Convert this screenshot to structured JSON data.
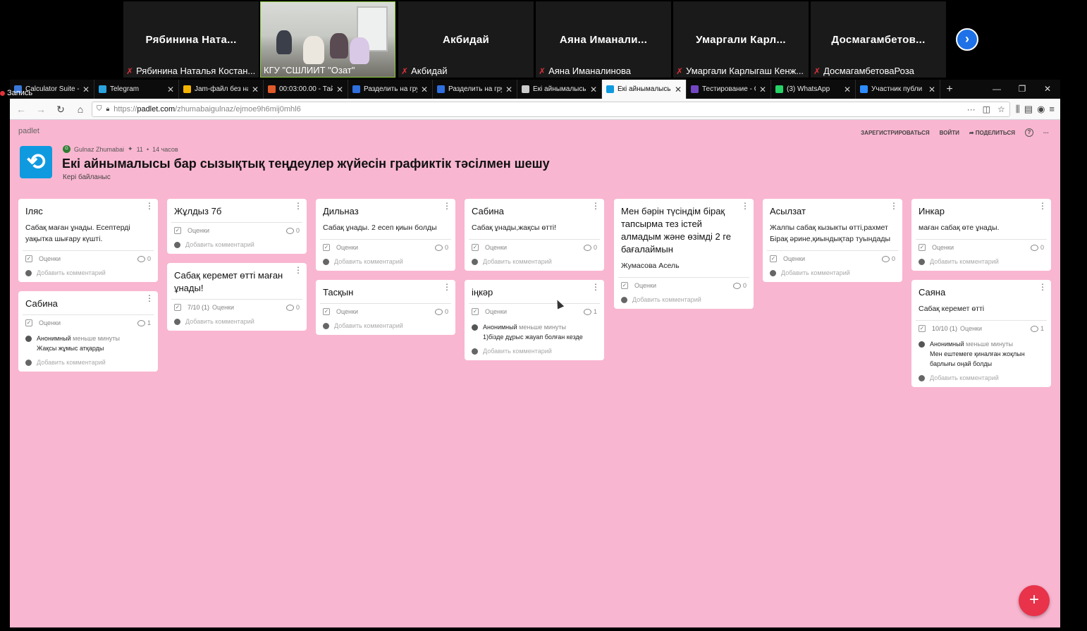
{
  "zoom": {
    "participants": [
      {
        "name": "Рябинина  Ната...",
        "label": "Рябинина Наталья Костан...",
        "video": false
      },
      {
        "name": "",
        "label": "КГУ \"СШЛИИТ \"Озат\"",
        "video": true
      },
      {
        "name": "Акбидай",
        "label": "Акбидай",
        "video": false
      },
      {
        "name": "Аяна  Иманали...",
        "label": "Аяна Иманалинова",
        "video": false
      },
      {
        "name": "Умаргали  Карл...",
        "label": "Умаргали Карлыгаш Кенж...",
        "video": false
      },
      {
        "name": "Досмагамбетов...",
        "label": "ДосмагамбетоваРоза",
        "video": false
      }
    ],
    "recording_label": "Запись",
    "next_icon": "chevron-right-icon"
  },
  "browser": {
    "tabs": [
      {
        "title": "Calculator Suite -",
        "favicon": "#3a78d8"
      },
      {
        "title": "Telegram",
        "favicon": "#2aa3df"
      },
      {
        "title": "Jam-файл без на",
        "favicon": "#f5b400"
      },
      {
        "title": "00:03:00.00 - Тайм",
        "favicon": "#e05a2b"
      },
      {
        "title": "Разделить на гру",
        "favicon": "#2f6fdf"
      },
      {
        "title": "Разделить на гру",
        "favicon": "#2f6fdf"
      },
      {
        "title": "Екі айнымалысы",
        "favicon": "#cccccc"
      },
      {
        "title": "Екі айнымалысы",
        "favicon": "#0f9ae0",
        "active": true
      },
      {
        "title": "Тестирование - G",
        "favicon": "#7346c4"
      },
      {
        "title": "(3) WhatsApp",
        "favicon": "#25d366"
      },
      {
        "title": "Участник публи",
        "favicon": "#2d8cff"
      }
    ],
    "url_scheme": "https://",
    "url_host": "padlet.com",
    "url_path": "/zhumabaigulnaz/ejmoe9h6mij0mhl6"
  },
  "padlet": {
    "brand": "padlet",
    "actions": {
      "signup": "ЗАРЕГИСТРИРОВАТЬСЯ",
      "login": "ВОЙТИ",
      "share": "ПОДЕЛИТЬСЯ"
    },
    "author": "Gulnaz Zhumabai",
    "author_initial": "G",
    "likes": "11",
    "time": "14 часов",
    "title": "Екі айнымалысы бар сызықтық теңдеулер жүйесін графиктік тәсілмен шешу",
    "subtitle": "Кері байланыс",
    "rate_label": "Оценки",
    "add_comment": "Добавить комментарий",
    "accent": "#f9b6d0",
    "columns": [
      [
        {
          "title": "Іляс",
          "body": "Сабақ маған ұнады. Есептерді уақытка шығару күшті.",
          "rating": "",
          "comments": "0",
          "cmts": []
        },
        {
          "title": "Сабина",
          "body": "",
          "rating": "",
          "comments": "1",
          "cmts": [
            {
              "who": "Анонимный",
              "when": "меньше минуты",
              "text": "Жақсы жұмыс атқарды"
            }
          ]
        }
      ],
      [
        {
          "title": "Жұлдыз 7б",
          "body": "",
          "rating": "",
          "comments": "0",
          "cmts": []
        },
        {
          "title": "Сабақ керемет өтті маған ұнады!",
          "body": "",
          "rating": "7/10 (1)",
          "comments": "0",
          "cmts": []
        }
      ],
      [
        {
          "title": "Дильназ",
          "body": "Сабақ ұнады. 2 есеп қиын болды",
          "rating": "",
          "comments": "0",
          "cmts": []
        },
        {
          "title": "Тасқын",
          "body": "",
          "rating": "",
          "comments": "0",
          "cmts": []
        }
      ],
      [
        {
          "title": "Сабина",
          "body": "Сабақ ұнады,жақсы өтті!",
          "rating": "",
          "comments": "0",
          "cmts": []
        },
        {
          "title": "іңкәр",
          "body": "",
          "rating": "",
          "comments": "1",
          "cmts": [
            {
              "who": "Анонимный",
              "when": "меньше минуты",
              "text": "1)бізде дұрыс жауап болған кезде"
            }
          ]
        }
      ],
      [
        {
          "title": "Мен бәрін түсіндім бірақ тапсырма тез істей алмадым және өзімді 2 ге бағалаймын",
          "body": "Жумасова Асель",
          "rating": "",
          "comments": "0",
          "cmts": []
        }
      ],
      [
        {
          "title": "Асылзат",
          "body": "Жалпы сабақ кызыкты өтті,рахмет\nБірақ әрине,қиындықтар туындады",
          "rating": "",
          "comments": "0",
          "cmts": []
        }
      ],
      [
        {
          "title": "Инкар",
          "body": "маған сабақ өте ұнады.",
          "rating": "",
          "comments": "0",
          "cmts": []
        },
        {
          "title": "Саяна",
          "body": "Сабақ керемет өтті",
          "rating": "10/10 (1)",
          "comments": "1",
          "cmts": [
            {
              "who": "Анонимный",
              "when": "меньше минуты",
              "text": "Мен ештемеге қиналған жоқлын барлығы оңай болды"
            }
          ]
        }
      ]
    ]
  }
}
